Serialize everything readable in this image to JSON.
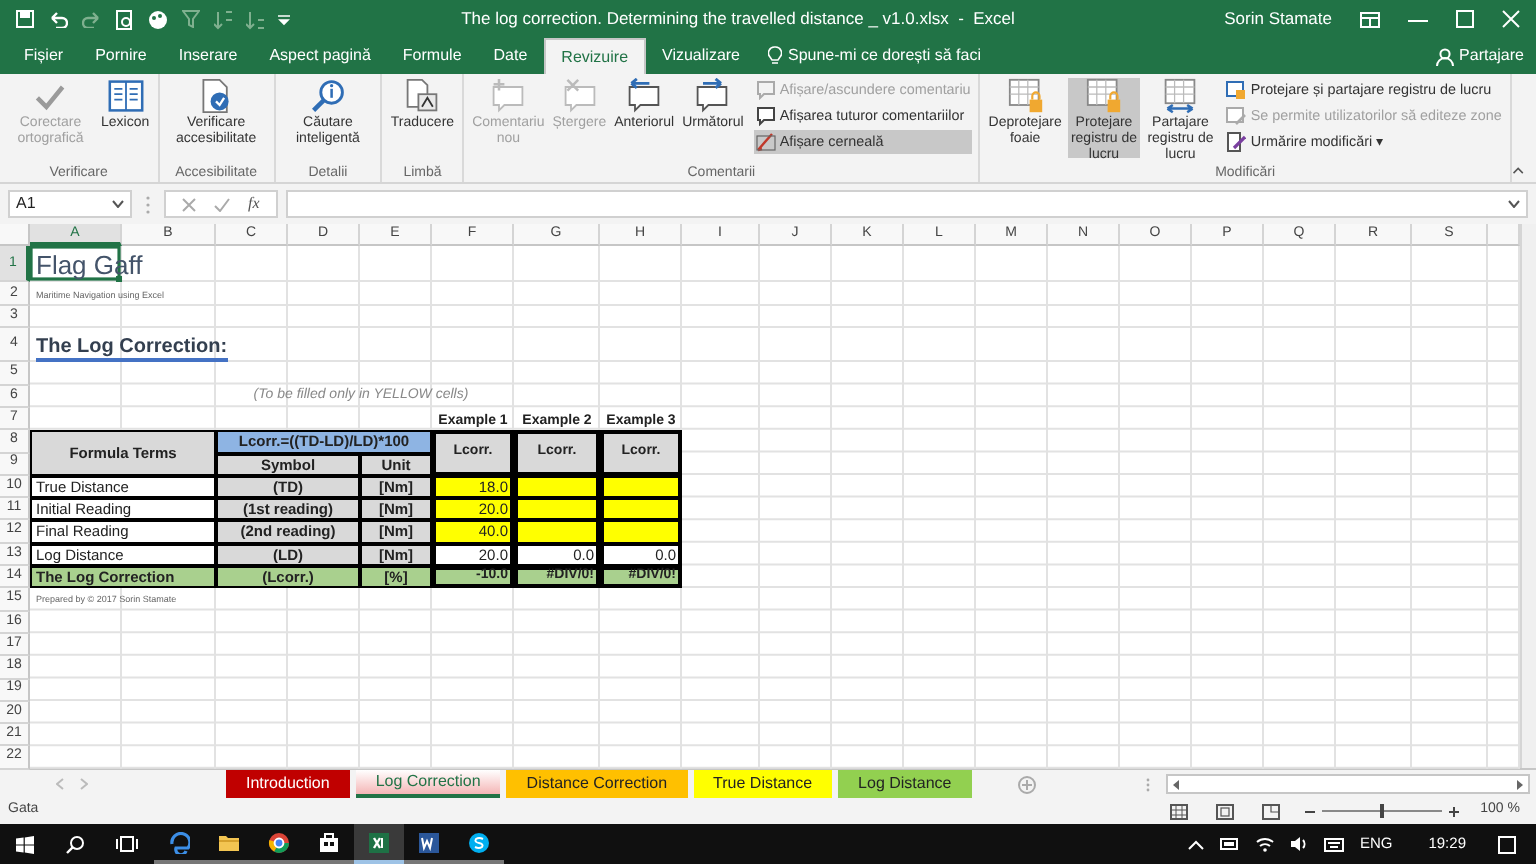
{
  "title_bar": {
    "title": "The log correction. Determining the travelled distance _ v1.0.xlsx  -  Excel",
    "user": "Sorin Stamate"
  },
  "ribbon_tabs": [
    {
      "label": "Fișier",
      "selected": false
    },
    {
      "label": "Pornire",
      "selected": false
    },
    {
      "label": "Inserare",
      "selected": false
    },
    {
      "label": "Aspect pagină",
      "selected": false
    },
    {
      "label": "Formule",
      "selected": false
    },
    {
      "label": "Date",
      "selected": false
    },
    {
      "label": "Revizuire",
      "selected": true
    },
    {
      "label": "Vizualizare",
      "selected": false
    }
  ],
  "tell_me": "Spune-mi ce dorești să faci",
  "share": "Partajare",
  "ribbon_groups": [
    {
      "label": "Verificare",
      "commands": [
        {
          "kind": "large",
          "label": "Corectare ortografică",
          "disabled": true,
          "selected": false
        },
        {
          "kind": "large",
          "label": "Lexicon",
          "disabled": false,
          "selected": false
        }
      ]
    },
    {
      "label": "Accesibilitate",
      "commands": [
        {
          "kind": "large",
          "label": "Verificare accesibilitate",
          "disabled": false,
          "selected": false
        }
      ]
    },
    {
      "label": "Detalii",
      "commands": [
        {
          "kind": "large",
          "label": "Căutare inteligentă",
          "disabled": false,
          "selected": false
        }
      ]
    },
    {
      "label": "Limbă",
      "commands": [
        {
          "kind": "large",
          "label": "Traducere",
          "disabled": false,
          "selected": false
        }
      ]
    },
    {
      "label": "Comentarii",
      "commands": [
        {
          "kind": "large",
          "label": "Comentariu nou",
          "disabled": true,
          "selected": false
        },
        {
          "kind": "large",
          "label": "Ștergere",
          "disabled": true,
          "selected": false
        },
        {
          "kind": "large",
          "label": "Anteriorul",
          "disabled": false,
          "selected": false
        },
        {
          "kind": "large",
          "label": "Următorul",
          "disabled": false,
          "selected": false
        },
        {
          "kind": "small",
          "label": "Afișare/ascundere comentariu",
          "disabled": true,
          "selected": false
        },
        {
          "kind": "small",
          "label": "Afișarea tuturor comentariilor",
          "disabled": false,
          "selected": false
        },
        {
          "kind": "small",
          "label": "Afișare cerneală",
          "disabled": false,
          "selected": true
        }
      ]
    },
    {
      "label": "Modificări",
      "commands": [
        {
          "kind": "large",
          "label": "Deprotejare foaie",
          "disabled": false,
          "selected": false
        },
        {
          "kind": "large",
          "label": "Protejare registru de lucru",
          "disabled": false,
          "selected": true
        },
        {
          "kind": "large",
          "label": "Partajare registru de lucru",
          "disabled": false,
          "selected": false
        },
        {
          "kind": "small",
          "label": "Protejare și partajare registru de lucru",
          "disabled": false,
          "selected": false
        },
        {
          "kind": "small",
          "label": "Se permite utilizatorilor să editeze zone",
          "disabled": true,
          "selected": false
        },
        {
          "kind": "small",
          "label": "Urmărire modificări ▾",
          "disabled": false,
          "selected": false
        }
      ]
    }
  ],
  "formula_bar": {
    "name_box": "A1",
    "function_label": "fx"
  },
  "columns": [
    {
      "label": "A",
      "selected": true
    },
    {
      "label": "B",
      "selected": false
    },
    {
      "label": "C",
      "selected": false
    },
    {
      "label": "D",
      "selected": false
    },
    {
      "label": "E",
      "selected": false
    },
    {
      "label": "F",
      "selected": false
    },
    {
      "label": "G",
      "selected": false
    },
    {
      "label": "H",
      "selected": false
    },
    {
      "label": "I",
      "selected": false
    },
    {
      "label": "J",
      "selected": false
    },
    {
      "label": "K",
      "selected": false
    },
    {
      "label": "L",
      "selected": false
    },
    {
      "label": "M",
      "selected": false
    },
    {
      "label": "N",
      "selected": false
    },
    {
      "label": "O",
      "selected": false
    },
    {
      "label": "P",
      "selected": false
    },
    {
      "label": "Q",
      "selected": false
    },
    {
      "label": "R",
      "selected": false
    },
    {
      "label": "S",
      "selected": false
    }
  ],
  "rows": [
    {
      "label": "1",
      "selected": true
    },
    {
      "label": "2",
      "selected": false
    },
    {
      "label": "3",
      "selected": false
    },
    {
      "label": "4",
      "selected": false
    },
    {
      "label": "5",
      "selected": false
    },
    {
      "label": "6",
      "selected": false
    },
    {
      "label": "7",
      "selected": false
    },
    {
      "label": "8",
      "selected": false
    },
    {
      "label": "9",
      "selected": false
    },
    {
      "label": "10",
      "selected": false
    },
    {
      "label": "11",
      "selected": false
    },
    {
      "label": "12",
      "selected": false
    },
    {
      "label": "13",
      "selected": false
    },
    {
      "label": "14",
      "selected": false
    },
    {
      "label": "15",
      "selected": false
    },
    {
      "label": "16",
      "selected": false
    },
    {
      "label": "17",
      "selected": false
    },
    {
      "label": "18",
      "selected": false
    },
    {
      "label": "19",
      "selected": false
    },
    {
      "label": "20",
      "selected": false
    },
    {
      "label": "21",
      "selected": false
    },
    {
      "label": "22",
      "selected": false
    }
  ],
  "cells": [
    {
      "kind": "title",
      "text": "Flag Gaff"
    },
    {
      "kind": "subtitle",
      "text": "Maritime Navigation using Excel"
    },
    {
      "kind": "heading",
      "text": "The Log Correction:"
    },
    {
      "kind": "note",
      "text": "(To be filled only in YELLOW cells)"
    },
    {
      "kind": "column-title",
      "text": "Example 1"
    },
    {
      "kind": "column-title",
      "text": "Example 2"
    },
    {
      "kind": "column-title",
      "text": "Example 3"
    },
    {
      "kind": "header",
      "text": "Formula Terms"
    },
    {
      "kind": "formula",
      "text": "Lcorr.=((TD-LD)/LD)*100"
    },
    {
      "kind": "result-header",
      "text": "Lcorr."
    },
    {
      "kind": "result-header",
      "text": "Lcorr."
    },
    {
      "kind": "result-header",
      "text": "Lcorr."
    },
    {
      "kind": "header",
      "text": "Symbol"
    },
    {
      "kind": "header",
      "text": "Unit"
    },
    {
      "kind": "label",
      "text": "True Distance"
    },
    {
      "kind": "symbol",
      "text": "(TD)"
    },
    {
      "kind": "symbol",
      "text": "[Nm]"
    },
    {
      "kind": "input",
      "text": "18.0"
    },
    {
      "kind": "input"
    },
    {
      "kind": "input"
    },
    {
      "kind": "label",
      "text": "Initial Reading"
    },
    {
      "kind": "symbol",
      "text": "(1st reading)"
    },
    {
      "kind": "symbol",
      "text": "[Nm]"
    },
    {
      "kind": "input",
      "text": "20.0"
    },
    {
      "kind": "input"
    },
    {
      "kind": "input"
    },
    {
      "kind": "label",
      "text": "Final Reading"
    },
    {
      "kind": "symbol",
      "text": "(2nd reading)"
    },
    {
      "kind": "symbol",
      "text": "[Nm]"
    },
    {
      "kind": "input",
      "text": "40.0"
    },
    {
      "kind": "input"
    },
    {
      "kind": "input"
    },
    {
      "kind": "label",
      "text": "Log Distance"
    },
    {
      "kind": "symbol",
      "text": "(LD)"
    },
    {
      "kind": "symbol",
      "text": "[Nm]"
    },
    {
      "kind": "value",
      "text": "20.0"
    },
    {
      "kind": "value",
      "text": "0.0"
    },
    {
      "kind": "value",
      "text": "0.0"
    },
    {
      "kind": "total-label",
      "text": "The Log Correction"
    },
    {
      "kind": "total-symbol",
      "text": "(Lcorr.)"
    },
    {
      "kind": "total-symbol",
      "text": "[%]"
    },
    {
      "kind": "total",
      "text": "-10.0"
    },
    {
      "kind": "total",
      "text": "#DIV/0!"
    },
    {
      "kind": "total",
      "text": "#DIV/0!"
    },
    {
      "kind": "credit",
      "text": "Prepared by © 2017 Sorin Stamate"
    }
  ],
  "sheet_tabs": [
    {
      "label": "Introduction",
      "color": "#c00000",
      "selected": false
    },
    {
      "label": "Log Correction",
      "color": "#f4b6b6",
      "selected": true
    },
    {
      "label": "Distance Correction",
      "color": "#ffc000",
      "selected": false
    },
    {
      "label": "True Distance",
      "color": "#ffff00",
      "selected": false
    },
    {
      "label": "Log Distance",
      "color": "#92d050",
      "selected": false
    }
  ],
  "status_bar": {
    "status": "Gata",
    "zoom": "100 %",
    "zoom_slider": {
      "level": 0.5
    }
  },
  "taskbar": {
    "apps": [
      {
        "kind": "browser",
        "selected": false
      },
      {
        "kind": "folder",
        "selected": false
      },
      {
        "kind": "chrome",
        "selected": false
      },
      {
        "kind": "store",
        "selected": false
      },
      {
        "kind": "sheet",
        "selected": true
      },
      {
        "kind": "doc",
        "selected": false
      },
      {
        "kind": "chat",
        "selected": false
      }
    ],
    "language": "ENG",
    "time": "19:29"
  }
}
